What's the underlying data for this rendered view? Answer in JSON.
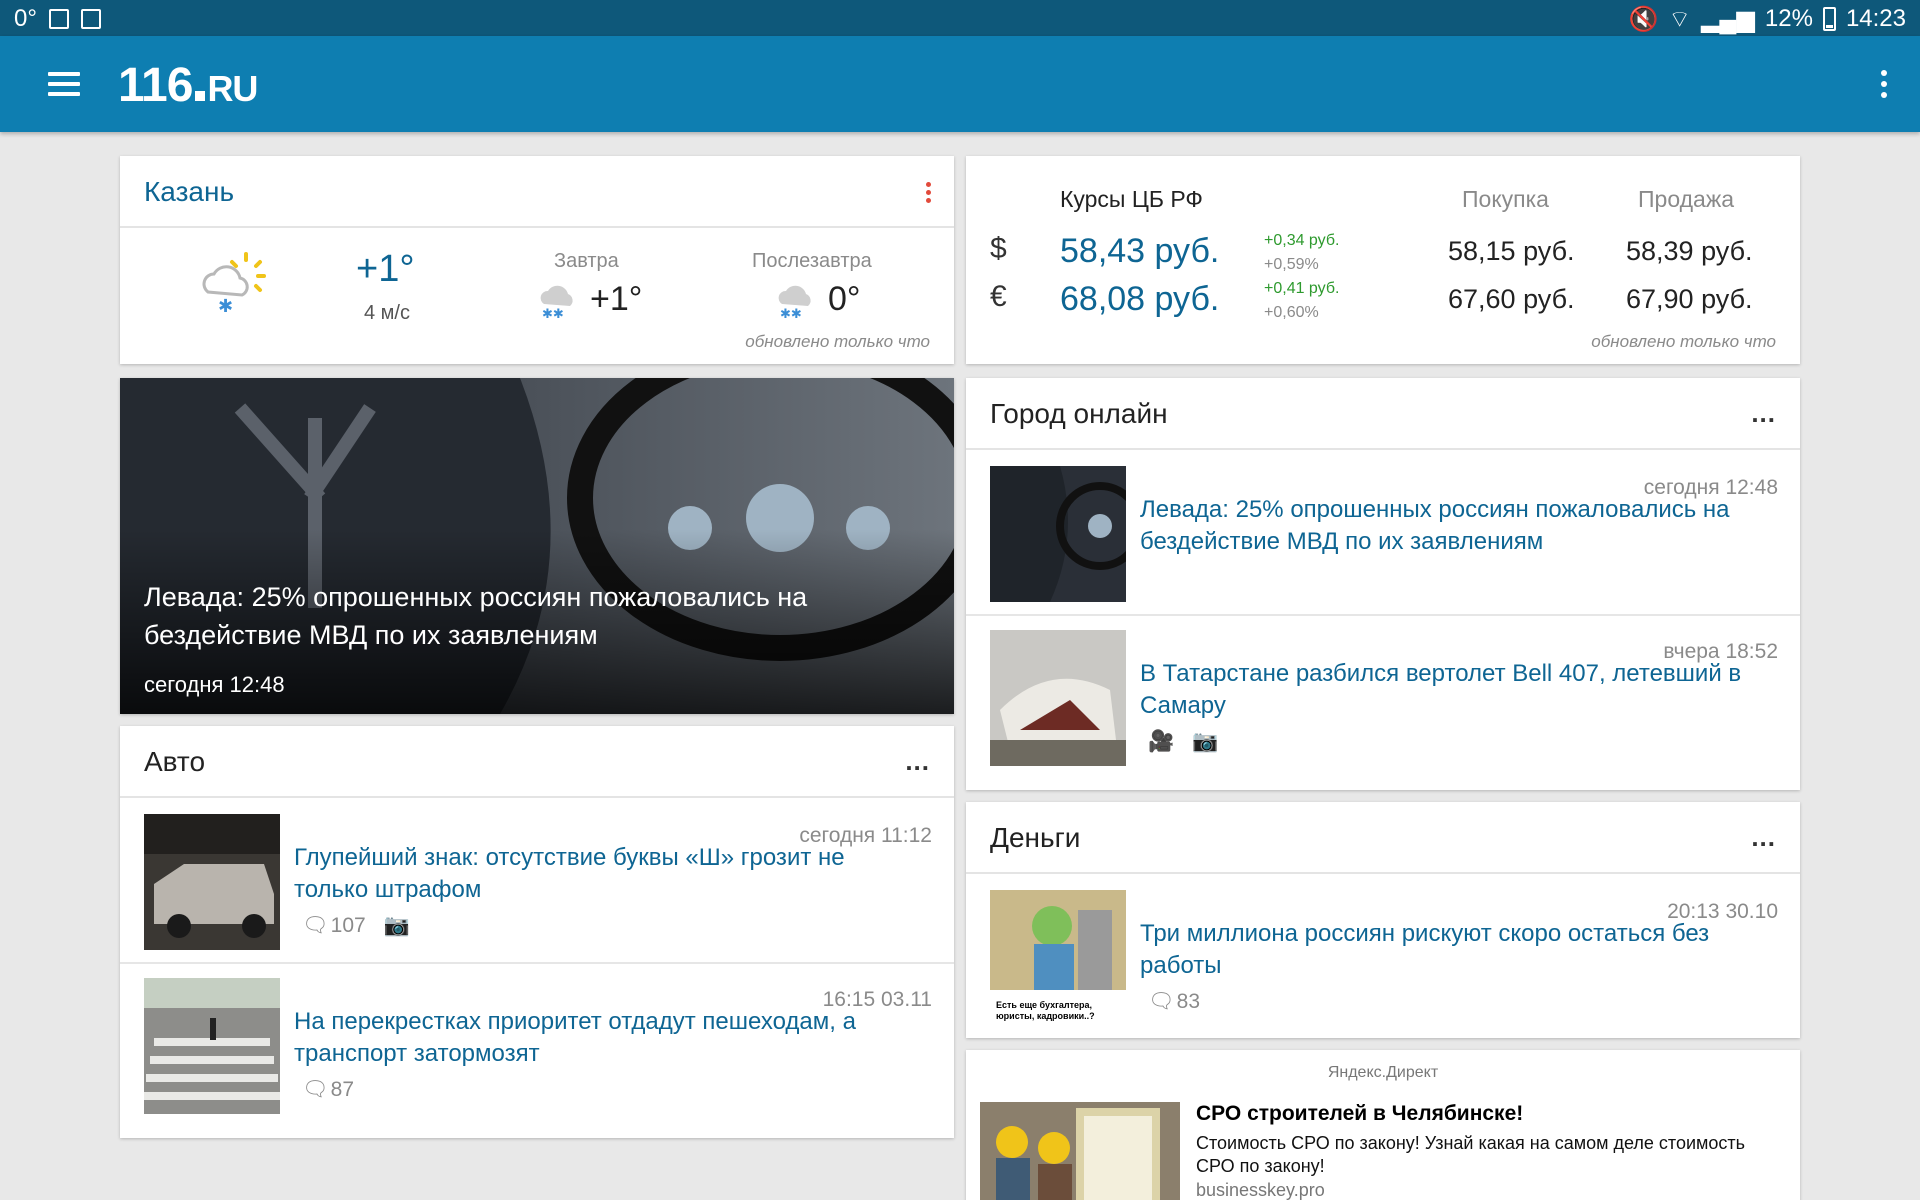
{
  "statusbar": {
    "temp": "0°",
    "battery": "12%",
    "time": "14:23"
  },
  "appbar": {
    "logo_main": "116",
    "logo_domain": "RU"
  },
  "weather": {
    "city": "Казань",
    "temp_now": "+1°",
    "wind": "4 м/с",
    "tomorrow_label": "Завтра",
    "tomorrow_temp": "+1°",
    "after_label": "Послезавтра",
    "after_temp": "0°",
    "updated": "обновлено только что"
  },
  "rates": {
    "title": "Курсы ЦБ РФ",
    "buy_label": "Покупка",
    "sell_label": "Продажа",
    "updated": "обновлено только что",
    "usd": {
      "symbol": "$",
      "value": "58,43 руб.",
      "change_abs": "+0,34 руб.",
      "change_pct": "+0,59%",
      "buy": "58,15 руб.",
      "sell": "58,39 руб."
    },
    "eur": {
      "symbol": "€",
      "value": "68,08 руб.",
      "change_abs": "+0,41 руб.",
      "change_pct": "+0,60%",
      "buy": "67,60 руб.",
      "sell": "67,90 руб."
    }
  },
  "hero": {
    "title": "Левада: 25% опрошенных россиян пожаловались на бездействие МВД по их заявлениям",
    "time": "сегодня 12:48"
  },
  "auto": {
    "title": "Авто",
    "more": "...",
    "items": [
      {
        "time": "сегодня 11:12",
        "title": "Глупейший знак: отсутствие буквы «Ш» грозит не только штрафом",
        "comments": "107"
      },
      {
        "time": "16:15 03.11",
        "title": "На перекрестках приоритет отдадут пешеходам, а транспорт затормозят",
        "comments": "87"
      }
    ]
  },
  "city_online": {
    "title": "Город онлайн",
    "more": "...",
    "items": [
      {
        "time": "сегодня 12:48",
        "title": "Левада: 25% опрошенных россиян пожаловались на бездействие МВД по их заявлениям"
      },
      {
        "time": "вчера 18:52",
        "title": "В Татарстане разбился вертолет Bell 407, летевший в Самару"
      }
    ]
  },
  "money": {
    "title": "Деньги",
    "more": "...",
    "items": [
      {
        "time": "20:13 30.10",
        "title": "Три миллиона россиян рискуют скоро остаться без работы",
        "comments": "83",
        "thumb_caption": "Есть еще бухгалтера, юристы, кадровики..?"
      }
    ]
  },
  "ad": {
    "source": "Яндекс.Директ",
    "title": "СРО строителей в Челябинске!",
    "text": "Стоимость СРО по закону! Узнай какая на самом деле стоимость СРО по закону!",
    "domain": "businesskey.pro"
  },
  "colors": {
    "appbar": "#0e7eb1",
    "statusbar": "#0e587a",
    "link": "#0e6593",
    "change": "#2e9a2e",
    "kebab_red": "#e24a3b"
  }
}
